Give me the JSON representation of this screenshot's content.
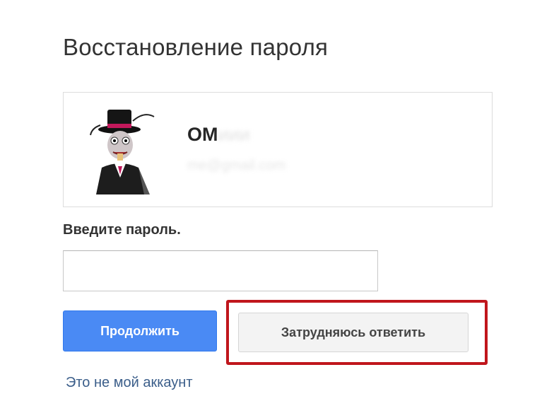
{
  "page": {
    "title": "Восстановление пароля"
  },
  "account": {
    "name_initial": "О",
    "name_rest": "M",
    "name_blurred": "иии",
    "email_blurred": "me@gmail.com",
    "avatar_icon": "top-hat-character-avatar-icon"
  },
  "form": {
    "password_label": "Введите пароль.",
    "password_value": "",
    "password_placeholder": ""
  },
  "buttons": {
    "continue_label": "Продолжить",
    "dont_know_label": "Затрудняюсь ответить"
  },
  "links": {
    "not_my_account": "Это не мой аккаунт"
  },
  "colors": {
    "primary": "#4a8af4",
    "highlight": "#c0161c",
    "link": "#3b5e8a"
  }
}
